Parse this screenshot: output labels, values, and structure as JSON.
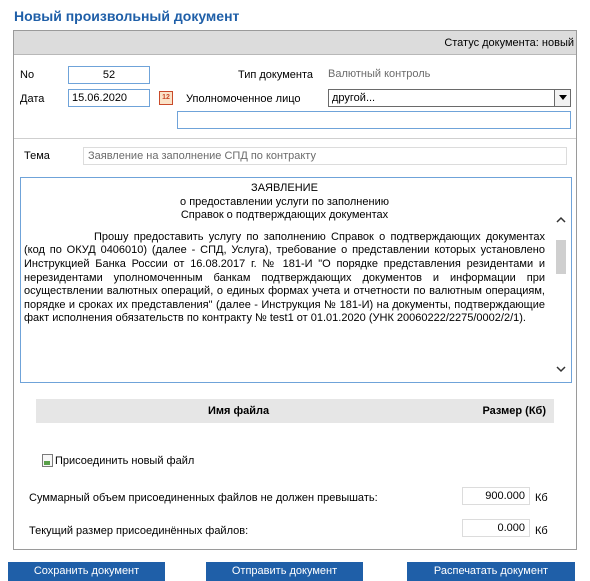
{
  "page_title": "Новый произвольный документ",
  "status": {
    "label": "Статус документа:",
    "value": "новый"
  },
  "fields": {
    "number_label": "No",
    "number_value": "52",
    "date_label": "Дата",
    "date_value": "15.06.2020",
    "calendar_icon_text": "12",
    "doc_type_label": "Тип документа",
    "doc_type_value": "Валютный контроль",
    "authorized_label": "Уполномоченное лицо",
    "authorized_value": "другой...",
    "extra_value": ""
  },
  "theme": {
    "label": "Тема",
    "value": "Заявление на заполнение СПД по контракту"
  },
  "document": {
    "heading": [
      "ЗАЯВЛЕНИЕ",
      "о предоставлении услуги по заполнению",
      "Справок о подтверждающих документах"
    ],
    "paragraph": "Прошу предоставить услугу по заполнению Справок о подтверждающих документах (код по ОКУД 0406010) (далее - СПД, Услуга), требование о представлении которых установлено Инструкцией Банка России от 16.08.2017 г. № 181-И \"О порядке представления резидентами и нерезидентами уполномоченным банкам подтверждающих документов и информации при осуществлении валютных операций, о единых формах учета и отчетности по валютным операциям, порядке и сроках их представления\" (далее - Инструкция № 181-И) на документы, подтверждающие факт исполнения обязательств по контракту № test1 от 01.01.2020 (УНК 20060222/2275/0002/2/1)."
  },
  "files": {
    "col_name": "Имя файла",
    "col_size": "Размер (Кб)",
    "attach_label": "Присоединить новый файл",
    "max_total_label": "Суммарный объем присоединенных файлов не должен превышать:",
    "max_total_value": "900.000",
    "max_total_unit": "Кб",
    "current_label": "Текущий размер присоединённых файлов:",
    "current_value": "0.000",
    "current_unit": "Кб"
  },
  "buttons": {
    "save": "Сохранить документ",
    "send": "Отправить документ",
    "print": "Распечатать документ"
  },
  "colors": {
    "accent": "#1f5fa8",
    "field_border": "#6fa3d9"
  }
}
